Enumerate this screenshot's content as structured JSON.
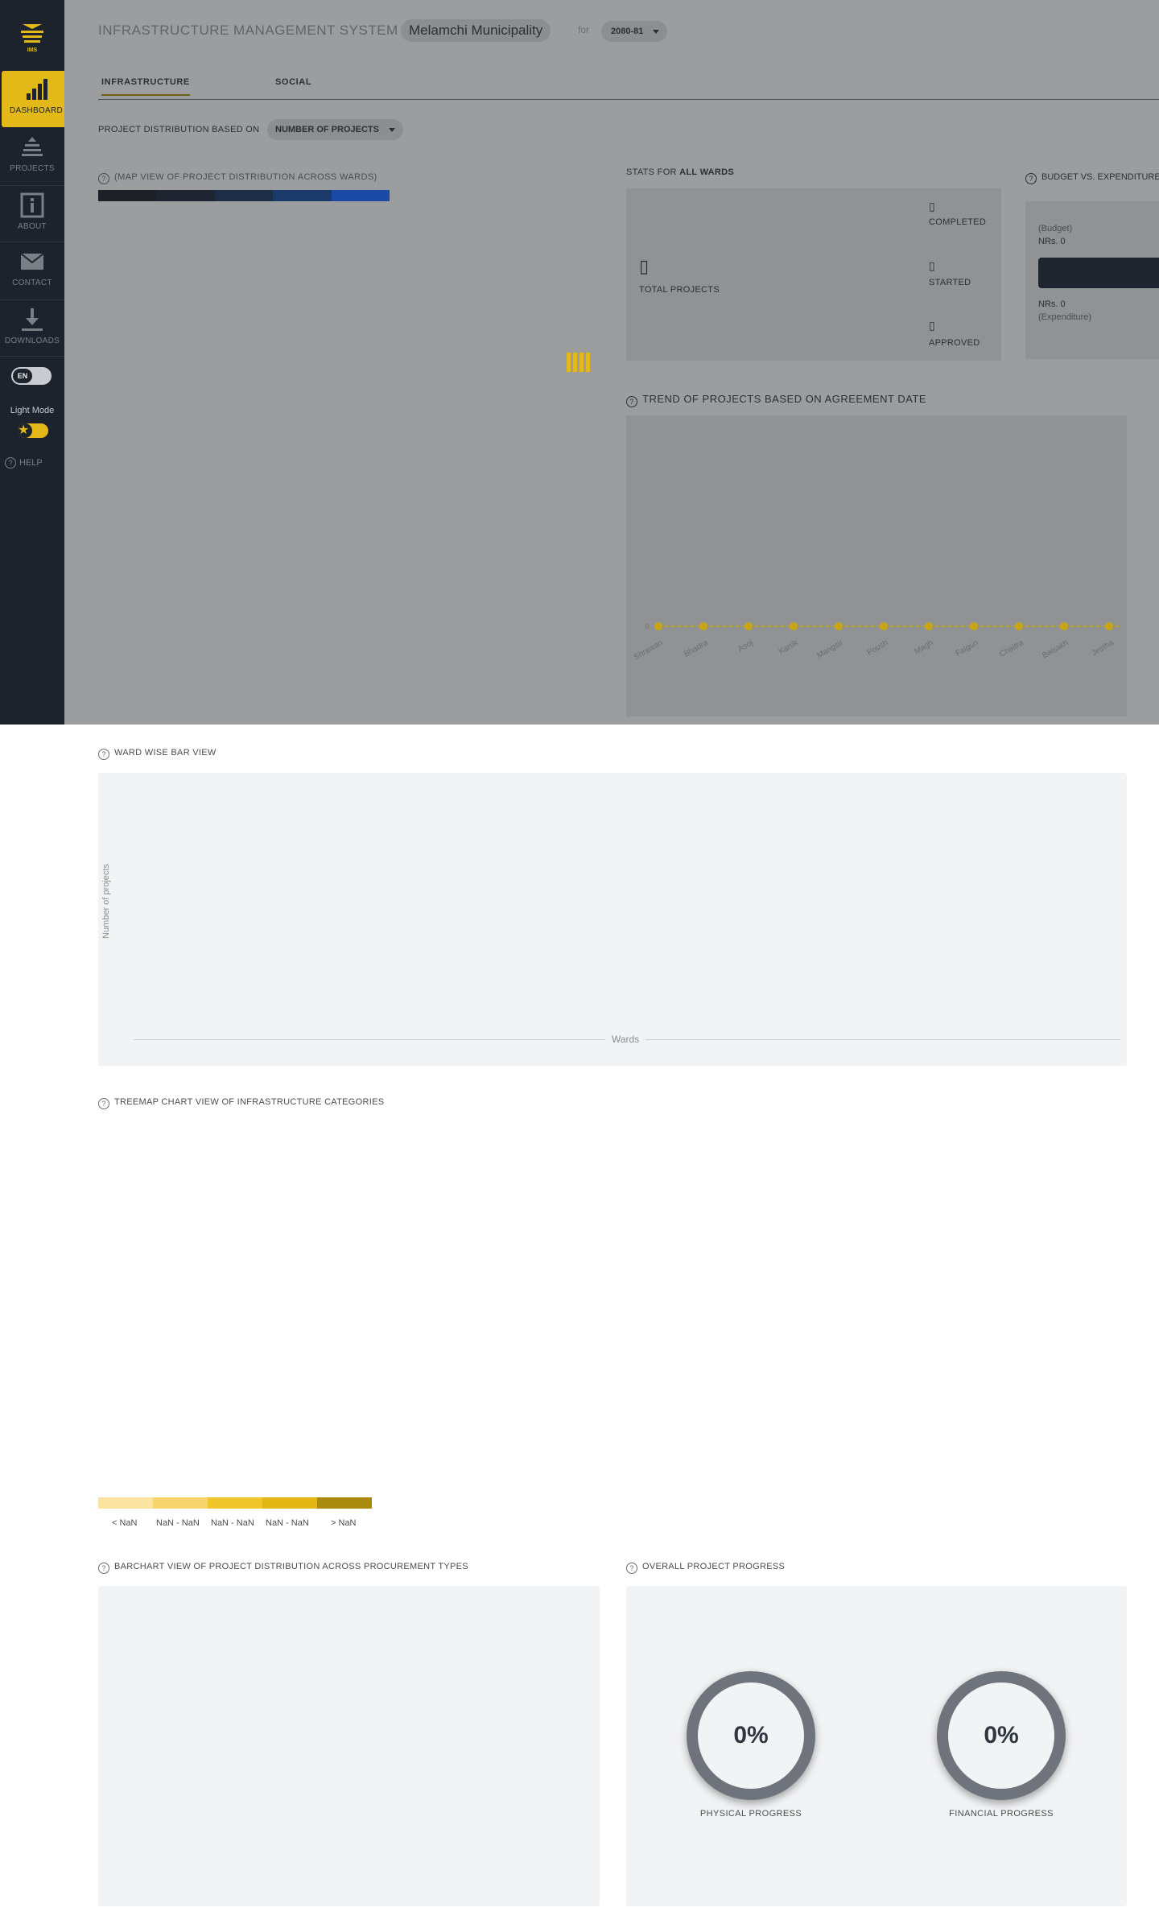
{
  "sidebar": {
    "logo_text": "IMS",
    "items": [
      {
        "label": "DASHBOARD",
        "icon": "bar-chart-icon"
      },
      {
        "label": "PROJECTS",
        "icon": "projects-icon"
      },
      {
        "label": "ABOUT",
        "icon": "info-icon"
      },
      {
        "label": "CONTACT",
        "icon": "mail-icon"
      },
      {
        "label": "DOWNLOADS",
        "icon": "download-icon"
      }
    ],
    "language": "EN",
    "mode_label": "Light Mode",
    "help_label": "HELP"
  },
  "header": {
    "title": "INFRASTRUCTURE MANAGEMENT SYSTEM",
    "municipality": "Melamchi Municipality",
    "for_label": "for",
    "fiscal_year": "2080-81"
  },
  "tabs": [
    "INFRASTRUCTURE",
    "SOCIAL"
  ],
  "distribution": {
    "label": "PROJECT DISTRIBUTION BASED ON",
    "selected": "NUMBER OF PROJECTS"
  },
  "map": {
    "title": "(MAP VIEW OF PROJECT DISTRIBUTION ACROSS WARDS)",
    "scale_colors": [
      "#1d2026",
      "#1e2430",
      "#1d2d45",
      "#1a3a6b",
      "#1a4aa3"
    ]
  },
  "stats": {
    "title_prefix": "STATS FOR",
    "title_bold": "ALL WARDS",
    "total_label": "TOTAL PROJECTS",
    "completed_label": "COMPLETED",
    "started_label": "STARTED",
    "approved_label": "APPROVED",
    "total_value": "▯",
    "completed_value": "▯",
    "started_value": "▯",
    "approved_value": "▯"
  },
  "budget": {
    "title": "BUDGET VS. EXPENDITURE",
    "budget_label": "(Budget)",
    "budget_value": "NRs. 0",
    "expenditure_value": "NRs. 0",
    "expenditure_label": "(Expenditure)"
  },
  "trend": {
    "title": "TREND OF PROJECTS BASED ON AGREEMENT DATE"
  },
  "ward_bar": {
    "title": "WARD WISE BAR VIEW",
    "ylabel": "Number of projects",
    "xlabel": "Wards"
  },
  "treemap": {
    "title": "TREEMAP CHART VIEW OF INFRASTRUCTURE CATEGORIES",
    "legend_colors": [
      "#fbe4a2",
      "#f6d36b",
      "#eec52a",
      "#e2b613",
      "#a98a0e"
    ],
    "legend_labels": [
      "< NaN",
      "NaN - NaN",
      "NaN - NaN",
      "NaN - NaN",
      "> NaN"
    ]
  },
  "procurement": {
    "title": "BARCHART VIEW OF PROJECT DISTRIBUTION ACROSS PROCUREMENT TYPES"
  },
  "progress": {
    "title": "OVERALL PROJECT PROGRESS",
    "physical_value": "0%",
    "physical_label": "PHYSICAL PROGRESS",
    "financial_value": "0%",
    "financial_label": "FINANCIAL PROGRESS"
  },
  "chart_data": {
    "type": "line",
    "title": "TREND OF PROJECTS BASED ON AGREEMENT DATE",
    "categories": [
      "Shrawan",
      "Bhadra",
      "Asoj",
      "Kartik",
      "Mangsir",
      "Poush",
      "Magh",
      "Falgun",
      "Chaitra",
      "Baisakh",
      "Jestha"
    ],
    "series": [
      {
        "values": [
          0,
          0,
          0,
          0,
          0,
          0,
          0,
          0,
          0,
          0,
          0
        ]
      }
    ],
    "ytick_labels": [
      "0"
    ],
    "colors": {
      "line": "#c9a614",
      "point": "#c9a614",
      "text": "#6b6d70"
    }
  }
}
